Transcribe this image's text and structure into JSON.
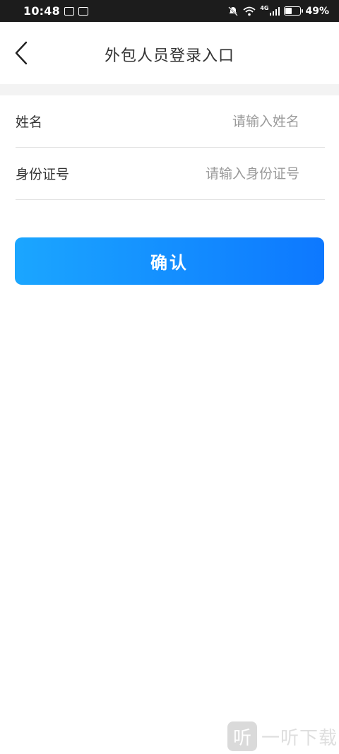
{
  "status_bar": {
    "time": "10:48",
    "network": "4G",
    "battery": "49%",
    "battery_level": 0.49,
    "icons": [
      "mute-icon",
      "wifi-icon",
      "signal-icon",
      "battery-icon"
    ]
  },
  "header": {
    "title": "外包人员登录入口",
    "back_icon": "chevron-left-icon"
  },
  "form": {
    "name": {
      "label": "姓名",
      "placeholder": "请输入姓名",
      "value": ""
    },
    "id_card": {
      "label": "身份证号",
      "placeholder": "请输入身份证号",
      "value": ""
    }
  },
  "confirm_button": {
    "label": "确认"
  },
  "watermark": {
    "logo_char": "听",
    "text": "一听下载"
  },
  "colors": {
    "accent_start": "#1ba6ff",
    "accent_end": "#0d78ff",
    "status_bar_bg": "#1c1c1c"
  }
}
